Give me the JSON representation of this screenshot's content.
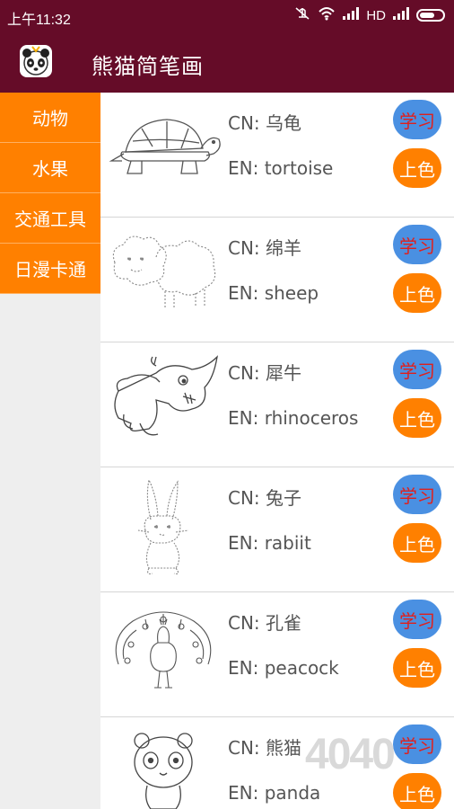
{
  "status": {
    "time": "上午11:32",
    "network": "HD"
  },
  "app": {
    "title": "熊猫简笔画"
  },
  "sidebar": {
    "items": [
      {
        "label": "动物"
      },
      {
        "label": "水果"
      },
      {
        "label": "交通工具"
      },
      {
        "label": "日漫卡通"
      }
    ]
  },
  "actions": {
    "learn_label": "学习",
    "color_label": "上色"
  },
  "list": {
    "items": [
      {
        "cn": "CN: 乌龟",
        "en": "EN: tortoise",
        "icon": "tortoise-sketch"
      },
      {
        "cn": "CN: 绵羊",
        "en": "EN: sheep",
        "icon": "sheep-sketch"
      },
      {
        "cn": "CN: 犀牛",
        "en": "EN: rhinoceros",
        "icon": "rhinoceros-sketch"
      },
      {
        "cn": "CN: 兔子",
        "en": "EN: rabiit",
        "icon": "rabbit-sketch"
      },
      {
        "cn": "CN: 孔雀",
        "en": "EN: peacock",
        "icon": "peacock-sketch"
      },
      {
        "cn": "CN: 熊猫",
        "en": "EN: panda",
        "icon": "panda-sketch"
      }
    ]
  },
  "watermark": {
    "text": "4040"
  },
  "colors": {
    "header": "#650c28",
    "accent": "#ff8000",
    "learn": "#4a90e2"
  }
}
